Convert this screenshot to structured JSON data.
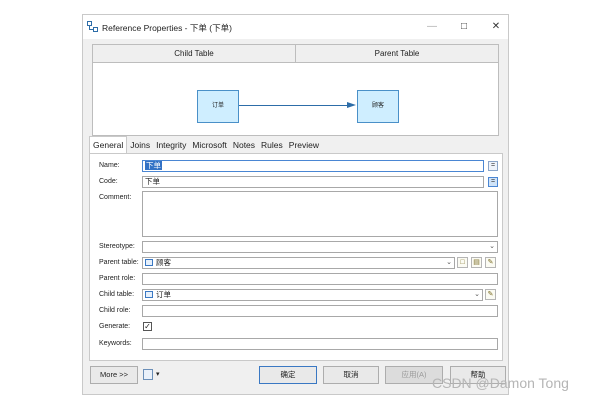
{
  "window": {
    "title": "Reference Properties - 下单 (下单)",
    "minimize": "—",
    "maximize": "□",
    "close": "✕"
  },
  "diagram": {
    "child_header": "Child Table",
    "parent_header": "Parent Table",
    "child_entity": "订单",
    "parent_entity": "顾客"
  },
  "tabs": [
    {
      "label": "General",
      "active": true
    },
    {
      "label": "Joins"
    },
    {
      "label": "Integrity"
    },
    {
      "label": "Microsoft"
    },
    {
      "label": "Notes"
    },
    {
      "label": "Rules"
    },
    {
      "label": "Preview"
    }
  ],
  "form": {
    "name_label": "Name:",
    "name_value": "下单",
    "name_btn": "=",
    "code_label": "Code:",
    "code_value": "下单",
    "code_btn": "=",
    "comment_label": "Comment:",
    "comment_value": "",
    "stereotype_label": "Stereotype:",
    "stereotype_value": "",
    "parent_table_label": "Parent table:",
    "parent_table_value": "顾客",
    "parent_role_label": "Parent role:",
    "parent_role_value": "",
    "child_table_label": "Child table:",
    "child_table_value": "订单",
    "child_role_label": "Child role:",
    "child_role_value": "",
    "generate_label": "Generate:",
    "generate_checked": "✓",
    "keywords_label": "Keywords:",
    "keywords_value": ""
  },
  "buttons": {
    "more": "More >>",
    "ok": "确定",
    "cancel": "取消",
    "apply": "应用(A)",
    "help": "帮助"
  },
  "watermark": "CSDN @Damon Tong",
  "colors": {
    "accent": "#3372c5",
    "entity_fill": "#cfeeff",
    "link": "#2d6da8"
  }
}
